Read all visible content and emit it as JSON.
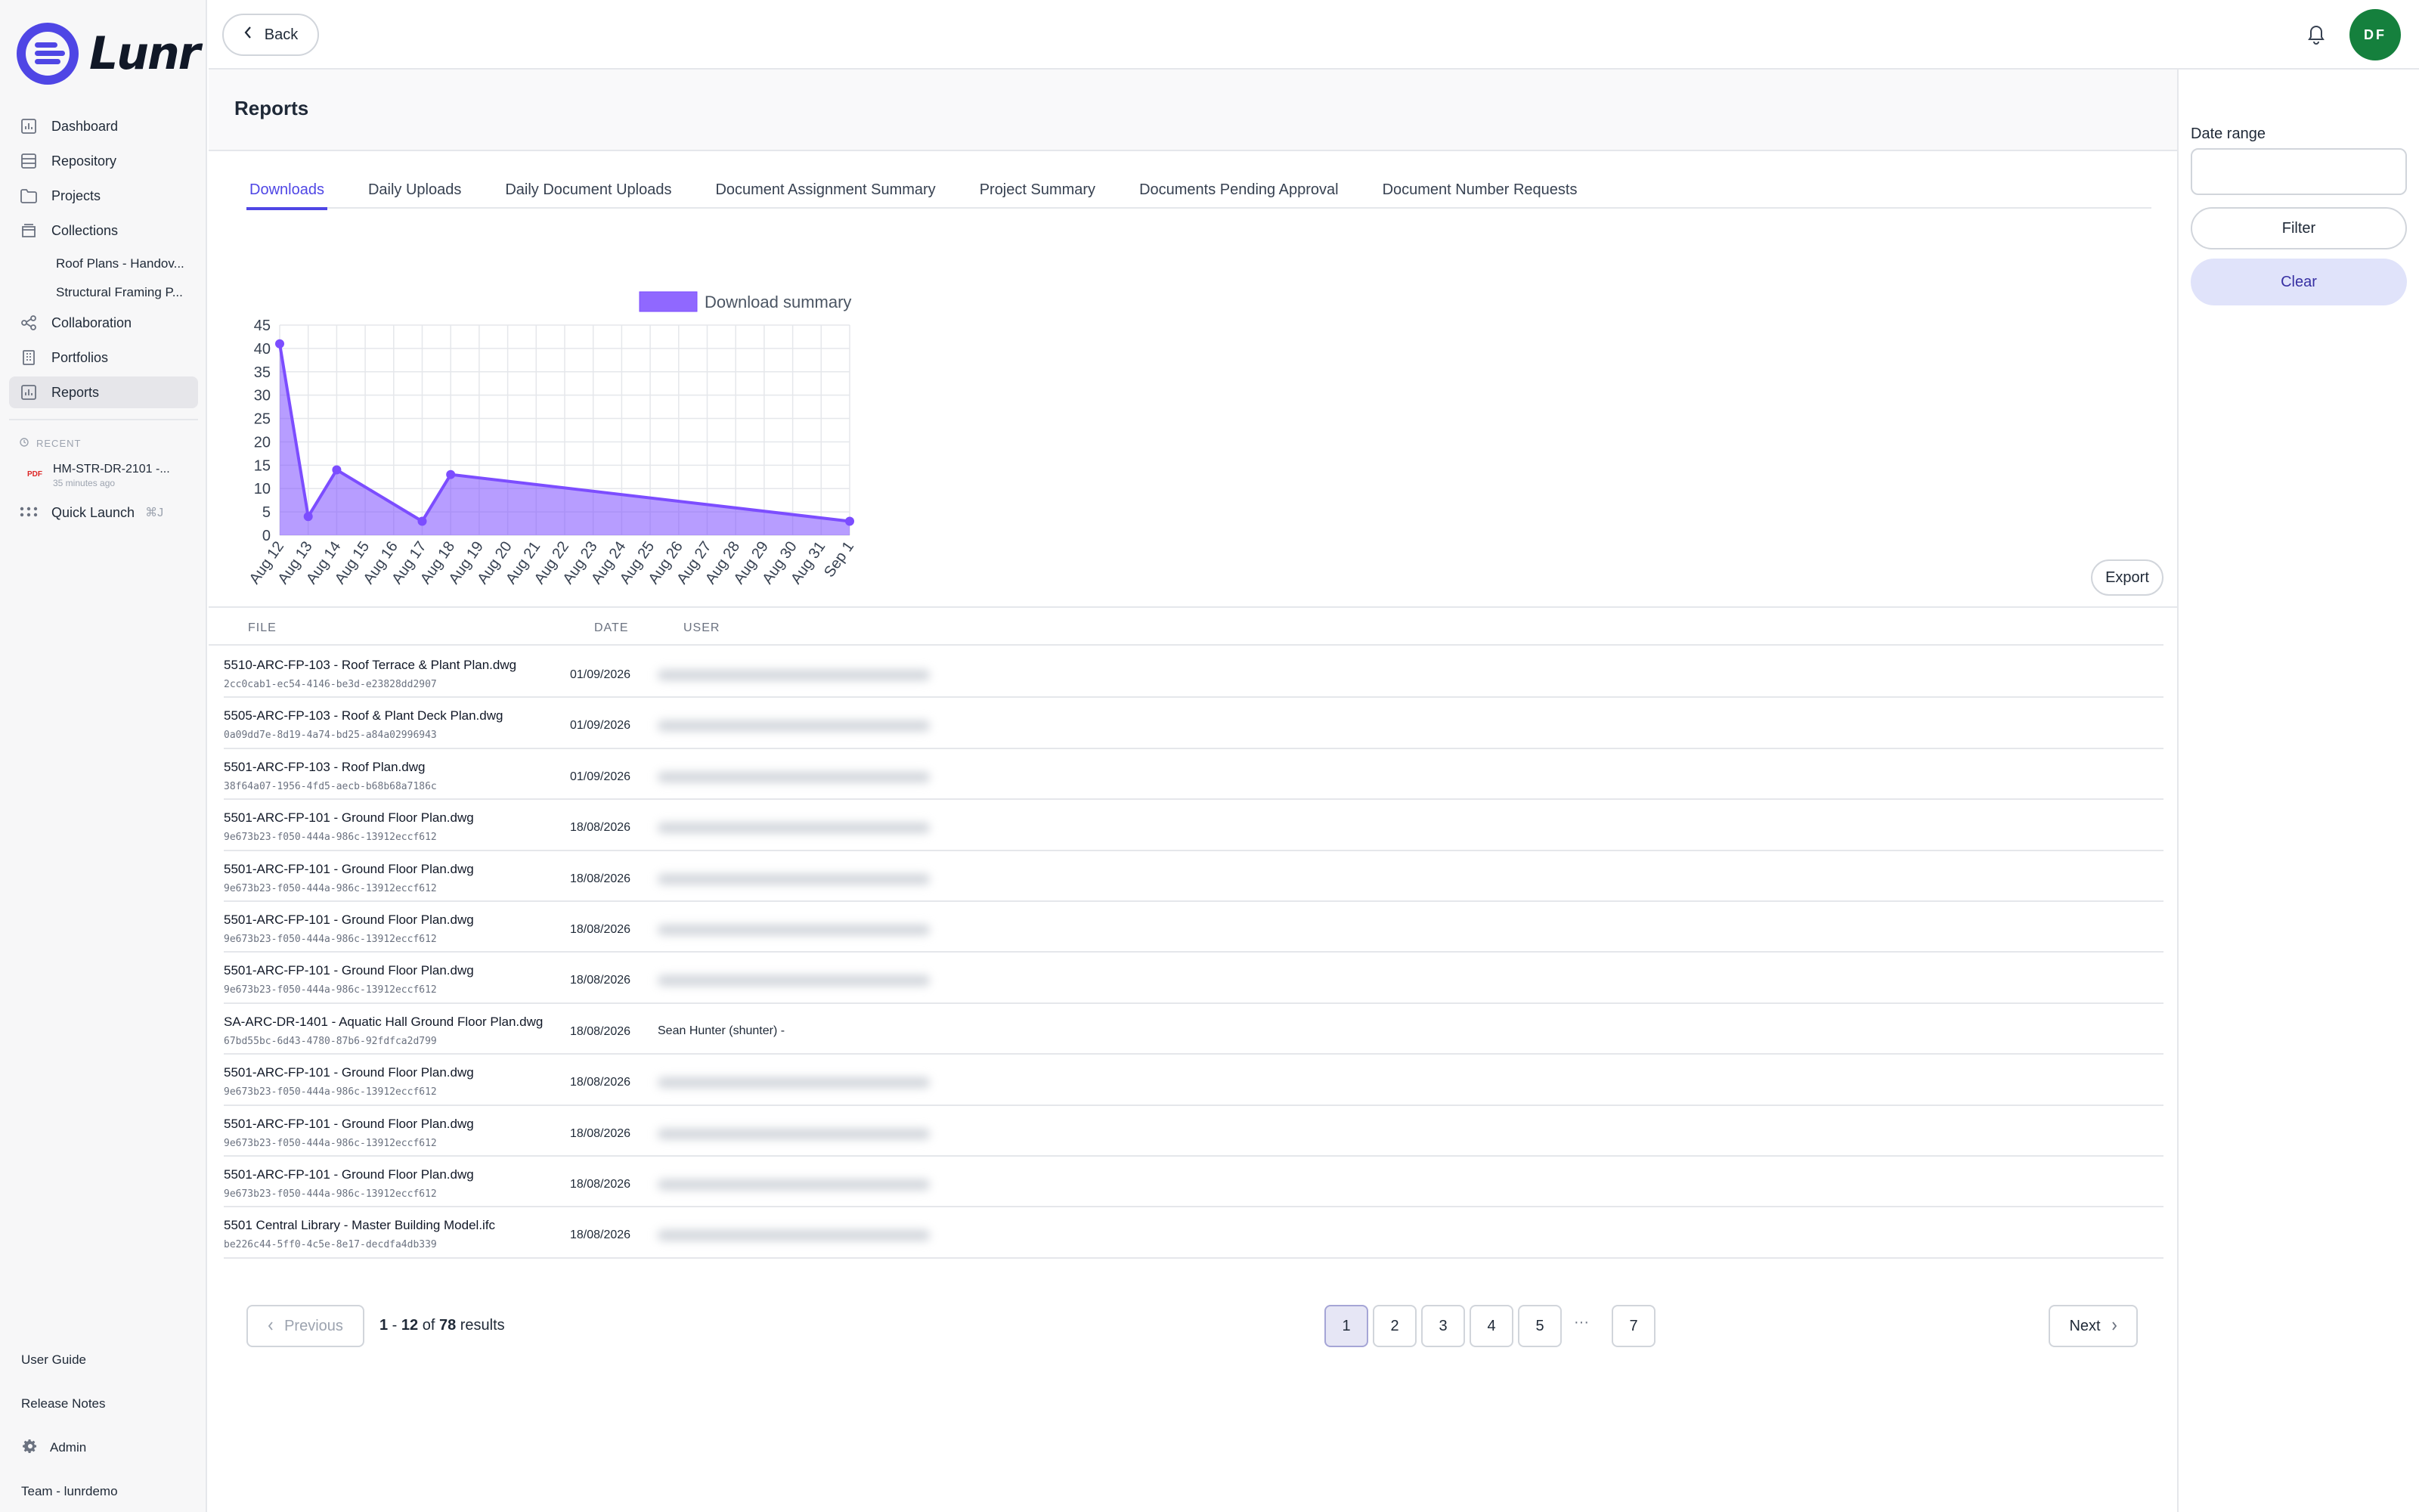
{
  "app": {
    "logo_text": "Lunr"
  },
  "sidebar": {
    "items": [
      {
        "label": "Dashboard",
        "icon": "dashboard-icon"
      },
      {
        "label": "Repository",
        "icon": "repository-icon"
      },
      {
        "label": "Projects",
        "icon": "folder-icon"
      },
      {
        "label": "Collections",
        "icon": "collections-icon"
      }
    ],
    "collections_sub": [
      "Roof Plans - Handov...",
      "Structural Framing P..."
    ],
    "items2": [
      {
        "label": "Collaboration",
        "icon": "share-icon"
      },
      {
        "label": "Portfolios",
        "icon": "building-icon"
      },
      {
        "label": "Reports",
        "icon": "report-icon"
      }
    ],
    "recent_label": "RECENT",
    "recent": {
      "badge": "PDF",
      "name": "HM-STR-DR-2101 -...",
      "time": "35 minutes ago"
    },
    "quick_launch": {
      "label": "Quick Launch",
      "shortcut": "⌘J"
    },
    "bottom": {
      "user_guide": "User Guide",
      "release_notes": "Release Notes",
      "admin": "Admin",
      "team": "Team - lunrdemo"
    }
  },
  "topbar": {
    "back_label": "Back",
    "avatar_initials": "DF"
  },
  "page": {
    "title": "Reports"
  },
  "tabs": [
    "Downloads",
    "Daily Uploads",
    "Daily Document Uploads",
    "Document Assignment Summary",
    "Project Summary",
    "Documents Pending Approval",
    "Document Number Requests"
  ],
  "chart_data": {
    "type": "area",
    "legend": [
      "Download summary"
    ],
    "legend_position": "top",
    "categories": [
      "Aug 12",
      "Aug 13",
      "Aug 14",
      "Aug 15",
      "Aug 16",
      "Aug 17",
      "Aug 18",
      "Aug 19",
      "Aug 20",
      "Aug 21",
      "Aug 22",
      "Aug 23",
      "Aug 24",
      "Aug 25",
      "Aug 26",
      "Aug 27",
      "Aug 28",
      "Aug 29",
      "Aug 30",
      "Aug 31",
      "Sep 1"
    ],
    "series": [
      {
        "name": "Download summary",
        "color": "#7c4dff",
        "points": [
          {
            "x": "Aug 12",
            "y": 41
          },
          {
            "x": "Aug 13",
            "y": 4
          },
          {
            "x": "Aug 14",
            "y": 14
          },
          {
            "x": "Aug 17",
            "y": 3
          },
          {
            "x": "Aug 18",
            "y": 13
          },
          {
            "x": "Sep 1",
            "y": 3
          }
        ]
      }
    ],
    "yticks": [
      0,
      5,
      10,
      15,
      20,
      25,
      30,
      35,
      40,
      45
    ],
    "ylim": [
      0,
      45
    ],
    "grid": true,
    "xlabel": "",
    "ylabel": ""
  },
  "export_label": "Export",
  "table": {
    "headers": {
      "file": "FILE",
      "date": "DATE",
      "user": "USER"
    },
    "rows": [
      {
        "file": "5510-ARC-FP-103 - Roof Terrace & Plant Plan.dwg",
        "id": "2cc0cab1-ec54-4146-be3d-e23828dd2907",
        "date": "01/09/2026",
        "user": "",
        "hidden": true
      },
      {
        "file": "5505-ARC-FP-103 - Roof & Plant Deck Plan.dwg",
        "id": "0a09dd7e-8d19-4a74-bd25-a84a02996943",
        "date": "01/09/2026",
        "user": "",
        "hidden": true
      },
      {
        "file": "5501-ARC-FP-103 - Roof Plan.dwg",
        "id": "38f64a07-1956-4fd5-aecb-b68b68a7186c",
        "date": "01/09/2026",
        "user": "",
        "hidden": true
      },
      {
        "file": "5501-ARC-FP-101 - Ground Floor Plan.dwg",
        "id": "9e673b23-f050-444a-986c-13912eccf612",
        "date": "18/08/2026",
        "user": "",
        "hidden": true
      },
      {
        "file": "5501-ARC-FP-101 - Ground Floor Plan.dwg",
        "id": "9e673b23-f050-444a-986c-13912eccf612",
        "date": "18/08/2026",
        "user": "",
        "hidden": true
      },
      {
        "file": "5501-ARC-FP-101 - Ground Floor Plan.dwg",
        "id": "9e673b23-f050-444a-986c-13912eccf612",
        "date": "18/08/2026",
        "user": "",
        "hidden": true
      },
      {
        "file": "5501-ARC-FP-101 - Ground Floor Plan.dwg",
        "id": "9e673b23-f050-444a-986c-13912eccf612",
        "date": "18/08/2026",
        "user": "",
        "hidden": true
      },
      {
        "file": "SA-ARC-DR-1401 - Aquatic Hall Ground Floor Plan.dwg",
        "id": "67bd55bc-6d43-4780-87b6-92fdfca2d799",
        "date": "18/08/2026",
        "user": "Sean Hunter (shunter) -",
        "hidden": false
      },
      {
        "file": "5501-ARC-FP-101 - Ground Floor Plan.dwg",
        "id": "9e673b23-f050-444a-986c-13912eccf612",
        "date": "18/08/2026",
        "user": "",
        "hidden": true
      },
      {
        "file": "5501-ARC-FP-101 - Ground Floor Plan.dwg",
        "id": "9e673b23-f050-444a-986c-13912eccf612",
        "date": "18/08/2026",
        "user": "",
        "hidden": true
      },
      {
        "file": "5501-ARC-FP-101 - Ground Floor Plan.dwg",
        "id": "9e673b23-f050-444a-986c-13912eccf612",
        "date": "18/08/2026",
        "user": "",
        "hidden": true
      },
      {
        "file": "5501 Central Library - Master Building Model.ifc",
        "id": "be226c44-5ff0-4c5e-8e17-decdfa4db339",
        "date": "18/08/2026",
        "user": "",
        "hidden": true
      }
    ]
  },
  "pagination": {
    "previous": "Previous",
    "next": "Next",
    "range_start": "1",
    "range_sep": " - ",
    "range_end": "12",
    "of": " of ",
    "total": "78",
    "results_word": " results",
    "pages": [
      "1",
      "2",
      "3",
      "4",
      "5"
    ],
    "ellipsis": "···",
    "last_page": "7",
    "current": "1"
  },
  "filter_panel": {
    "date_range_label": "Date range",
    "date_range_value": "",
    "filter_label": "Filter",
    "clear_label": "Clear"
  }
}
